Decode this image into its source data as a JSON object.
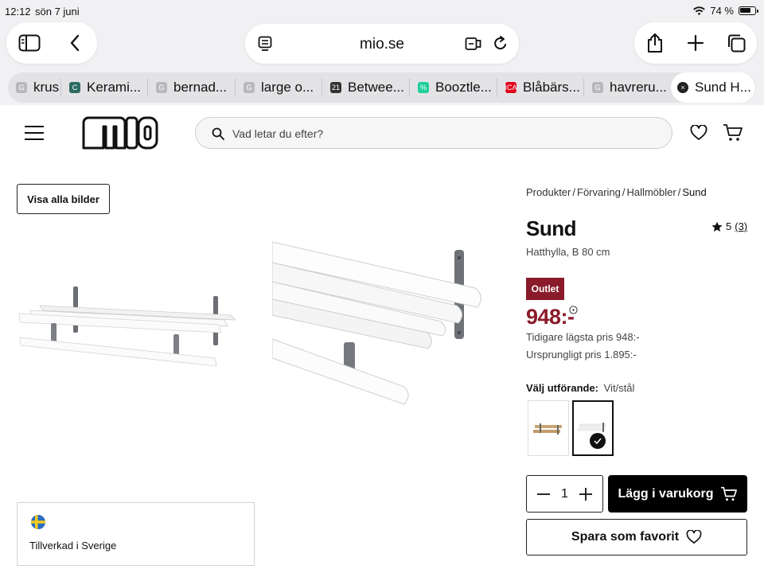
{
  "status_bar": {
    "time": "12:12",
    "date": "sön 7 juni",
    "battery": "74 %"
  },
  "browser": {
    "url": "mio.se",
    "tabs": [
      {
        "label": "krus",
        "fav": "G",
        "fav_color": "#b9b9bd"
      },
      {
        "label": "Kerami...",
        "fav": "C",
        "fav_color": "#2e6b63"
      },
      {
        "label": "bernad...",
        "fav": "G",
        "fav_color": "#b9b9bd"
      },
      {
        "label": "large o...",
        "fav": "G",
        "fav_color": "#b9b9bd"
      },
      {
        "label": "Betwee...",
        "fav": "21",
        "fav_color": "#333333"
      },
      {
        "label": "Booztle...",
        "fav": "%",
        "fav_color": "#1fcf9c"
      },
      {
        "label": "Blåbärs...",
        "fav": "ICA",
        "fav_color": "#e2001a"
      },
      {
        "label": "havreru...",
        "fav": "G",
        "fav_color": "#b9b9bd"
      },
      {
        "label": "Sund H...",
        "fav": "×",
        "fav_color": "#222222"
      }
    ]
  },
  "site": {
    "logo": "mio",
    "search_placeholder": "Vad letar du efter?"
  },
  "gallery": {
    "show_all_button": "Visa alla bilder",
    "badge_text": "Tillverkad i Sverige"
  },
  "breadcrumb": [
    {
      "label": "Produkter"
    },
    {
      "label": "Förvaring"
    },
    {
      "label": "Hallmöbler"
    },
    {
      "label": "Sund"
    }
  ],
  "product": {
    "name": "Sund",
    "subtitle": "Hatthylla, B 80 cm",
    "rating": "5",
    "review_count": "(3)",
    "tag": "Outlet",
    "price": "948:-",
    "lowest_price": "Tidigare lägsta pris 948:-",
    "original_price": "Ursprungligt pris 1.895:-",
    "variant_label": "Välj utförande:",
    "variant_value": "Vit/stål",
    "quantity": "1",
    "add_to_cart": "Lägg i varukorg",
    "save_favorite": "Spara som favorit"
  },
  "colors": {
    "price": "#8a1b2b",
    "tag_bg": "#8a1b2b"
  }
}
